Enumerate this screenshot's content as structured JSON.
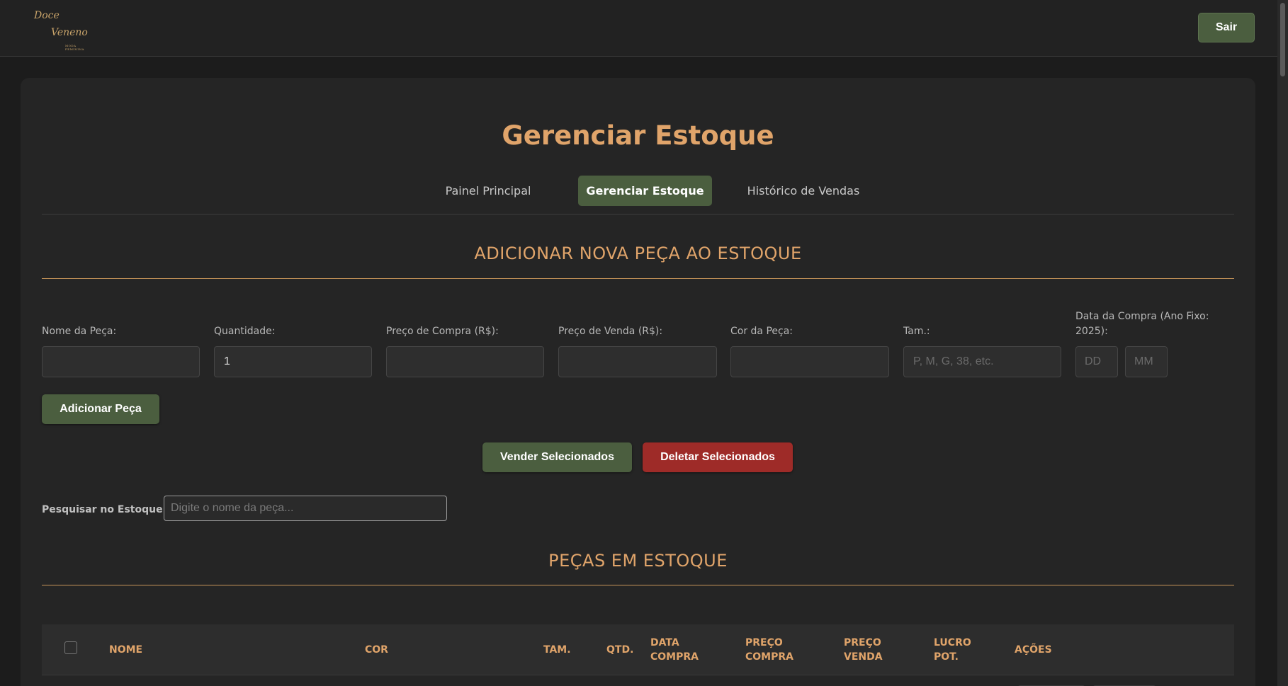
{
  "header": {
    "logo": {
      "line1": "Doce",
      "line2": "Veneno",
      "line3": "MODA FEMININA"
    },
    "logout_label": "Sair"
  },
  "page": {
    "title": "Gerenciar Estoque"
  },
  "nav": {
    "items": [
      {
        "label": "Painel Principal",
        "active": false
      },
      {
        "label": "Gerenciar Estoque",
        "active": true
      },
      {
        "label": "Histórico de Vendas",
        "active": false
      }
    ]
  },
  "add_form": {
    "section_title": "ADICIONAR NOVA PEÇA AO ESTOQUE",
    "fields": [
      {
        "label": "Nome da Peça:",
        "value": "",
        "placeholder": ""
      },
      {
        "label": "Quantidade:",
        "value": "1",
        "placeholder": ""
      },
      {
        "label": "Preço de Compra (R$):",
        "value": "",
        "placeholder": ""
      },
      {
        "label": "Preço de Venda (R$):",
        "value": "",
        "placeholder": ""
      },
      {
        "label": "Cor da Peça:",
        "value": "",
        "placeholder": ""
      },
      {
        "label": "Tam.:",
        "value": "",
        "placeholder": "P, M, G, 38, etc."
      }
    ],
    "date_label": "Data da Compra (Ano Fixo: 2025):",
    "date_day_placeholder": "DD",
    "date_month_placeholder": "MM",
    "add_button": "Adicionar Peça"
  },
  "bulk_actions": {
    "sell_label": "Vender Selecionados",
    "delete_label": "Deletar Selecionados"
  },
  "search": {
    "label": "Pesquisar no Estoque:",
    "placeholder": "Digite o nome da peça..."
  },
  "stock": {
    "section_title": "PEÇAS EM ESTOQUE",
    "columns": [
      "NOME",
      "COR",
      "TAM.",
      "QTD.",
      "DATA COMPRA",
      "PREÇO COMPRA",
      "PREÇO VENDA",
      "LUCRO POT.",
      "AÇÕES"
    ]
  },
  "colors": {
    "accent": "#e0a46a",
    "primary_button": "#4b5e3f",
    "danger_button": "#9e2b28",
    "background": "#1c1c1c",
    "card": "#252525"
  }
}
